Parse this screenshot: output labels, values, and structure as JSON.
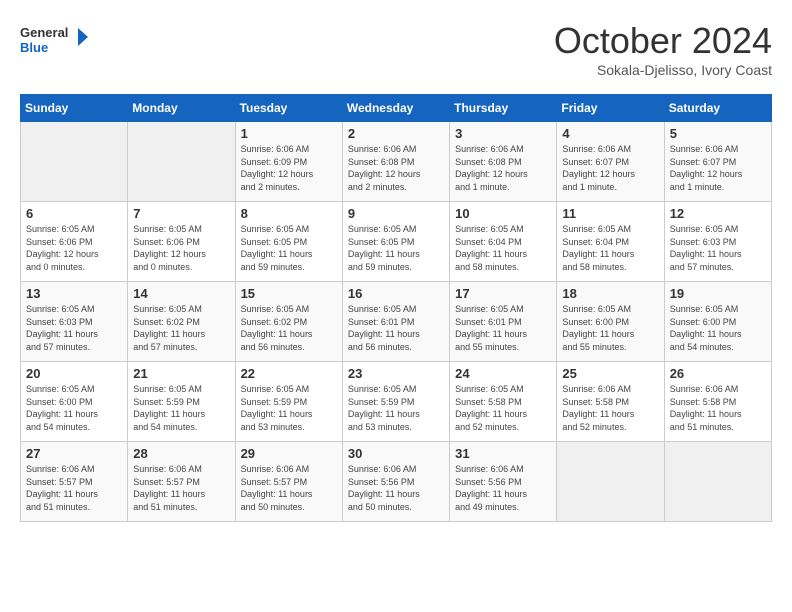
{
  "header": {
    "logo_general": "General",
    "logo_blue": "Blue",
    "month": "October 2024",
    "location": "Sokala-Djelisso, Ivory Coast"
  },
  "days_of_week": [
    "Sunday",
    "Monday",
    "Tuesday",
    "Wednesday",
    "Thursday",
    "Friday",
    "Saturday"
  ],
  "weeks": [
    [
      {
        "day": "",
        "info": ""
      },
      {
        "day": "",
        "info": ""
      },
      {
        "day": "1",
        "info": "Sunrise: 6:06 AM\nSunset: 6:09 PM\nDaylight: 12 hours\nand 2 minutes."
      },
      {
        "day": "2",
        "info": "Sunrise: 6:06 AM\nSunset: 6:08 PM\nDaylight: 12 hours\nand 2 minutes."
      },
      {
        "day": "3",
        "info": "Sunrise: 6:06 AM\nSunset: 6:08 PM\nDaylight: 12 hours\nand 1 minute."
      },
      {
        "day": "4",
        "info": "Sunrise: 6:06 AM\nSunset: 6:07 PM\nDaylight: 12 hours\nand 1 minute."
      },
      {
        "day": "5",
        "info": "Sunrise: 6:06 AM\nSunset: 6:07 PM\nDaylight: 12 hours\nand 1 minute."
      }
    ],
    [
      {
        "day": "6",
        "info": "Sunrise: 6:05 AM\nSunset: 6:06 PM\nDaylight: 12 hours\nand 0 minutes."
      },
      {
        "day": "7",
        "info": "Sunrise: 6:05 AM\nSunset: 6:06 PM\nDaylight: 12 hours\nand 0 minutes."
      },
      {
        "day": "8",
        "info": "Sunrise: 6:05 AM\nSunset: 6:05 PM\nDaylight: 11 hours\nand 59 minutes."
      },
      {
        "day": "9",
        "info": "Sunrise: 6:05 AM\nSunset: 6:05 PM\nDaylight: 11 hours\nand 59 minutes."
      },
      {
        "day": "10",
        "info": "Sunrise: 6:05 AM\nSunset: 6:04 PM\nDaylight: 11 hours\nand 58 minutes."
      },
      {
        "day": "11",
        "info": "Sunrise: 6:05 AM\nSunset: 6:04 PM\nDaylight: 11 hours\nand 58 minutes."
      },
      {
        "day": "12",
        "info": "Sunrise: 6:05 AM\nSunset: 6:03 PM\nDaylight: 11 hours\nand 57 minutes."
      }
    ],
    [
      {
        "day": "13",
        "info": "Sunrise: 6:05 AM\nSunset: 6:03 PM\nDaylight: 11 hours\nand 57 minutes."
      },
      {
        "day": "14",
        "info": "Sunrise: 6:05 AM\nSunset: 6:02 PM\nDaylight: 11 hours\nand 57 minutes."
      },
      {
        "day": "15",
        "info": "Sunrise: 6:05 AM\nSunset: 6:02 PM\nDaylight: 11 hours\nand 56 minutes."
      },
      {
        "day": "16",
        "info": "Sunrise: 6:05 AM\nSunset: 6:01 PM\nDaylight: 11 hours\nand 56 minutes."
      },
      {
        "day": "17",
        "info": "Sunrise: 6:05 AM\nSunset: 6:01 PM\nDaylight: 11 hours\nand 55 minutes."
      },
      {
        "day": "18",
        "info": "Sunrise: 6:05 AM\nSunset: 6:00 PM\nDaylight: 11 hours\nand 55 minutes."
      },
      {
        "day": "19",
        "info": "Sunrise: 6:05 AM\nSunset: 6:00 PM\nDaylight: 11 hours\nand 54 minutes."
      }
    ],
    [
      {
        "day": "20",
        "info": "Sunrise: 6:05 AM\nSunset: 6:00 PM\nDaylight: 11 hours\nand 54 minutes."
      },
      {
        "day": "21",
        "info": "Sunrise: 6:05 AM\nSunset: 5:59 PM\nDaylight: 11 hours\nand 54 minutes."
      },
      {
        "day": "22",
        "info": "Sunrise: 6:05 AM\nSunset: 5:59 PM\nDaylight: 11 hours\nand 53 minutes."
      },
      {
        "day": "23",
        "info": "Sunrise: 6:05 AM\nSunset: 5:59 PM\nDaylight: 11 hours\nand 53 minutes."
      },
      {
        "day": "24",
        "info": "Sunrise: 6:05 AM\nSunset: 5:58 PM\nDaylight: 11 hours\nand 52 minutes."
      },
      {
        "day": "25",
        "info": "Sunrise: 6:06 AM\nSunset: 5:58 PM\nDaylight: 11 hours\nand 52 minutes."
      },
      {
        "day": "26",
        "info": "Sunrise: 6:06 AM\nSunset: 5:58 PM\nDaylight: 11 hours\nand 51 minutes."
      }
    ],
    [
      {
        "day": "27",
        "info": "Sunrise: 6:06 AM\nSunset: 5:57 PM\nDaylight: 11 hours\nand 51 minutes."
      },
      {
        "day": "28",
        "info": "Sunrise: 6:06 AM\nSunset: 5:57 PM\nDaylight: 11 hours\nand 51 minutes."
      },
      {
        "day": "29",
        "info": "Sunrise: 6:06 AM\nSunset: 5:57 PM\nDaylight: 11 hours\nand 50 minutes."
      },
      {
        "day": "30",
        "info": "Sunrise: 6:06 AM\nSunset: 5:56 PM\nDaylight: 11 hours\nand 50 minutes."
      },
      {
        "day": "31",
        "info": "Sunrise: 6:06 AM\nSunset: 5:56 PM\nDaylight: 11 hours\nand 49 minutes."
      },
      {
        "day": "",
        "info": ""
      },
      {
        "day": "",
        "info": ""
      }
    ]
  ]
}
